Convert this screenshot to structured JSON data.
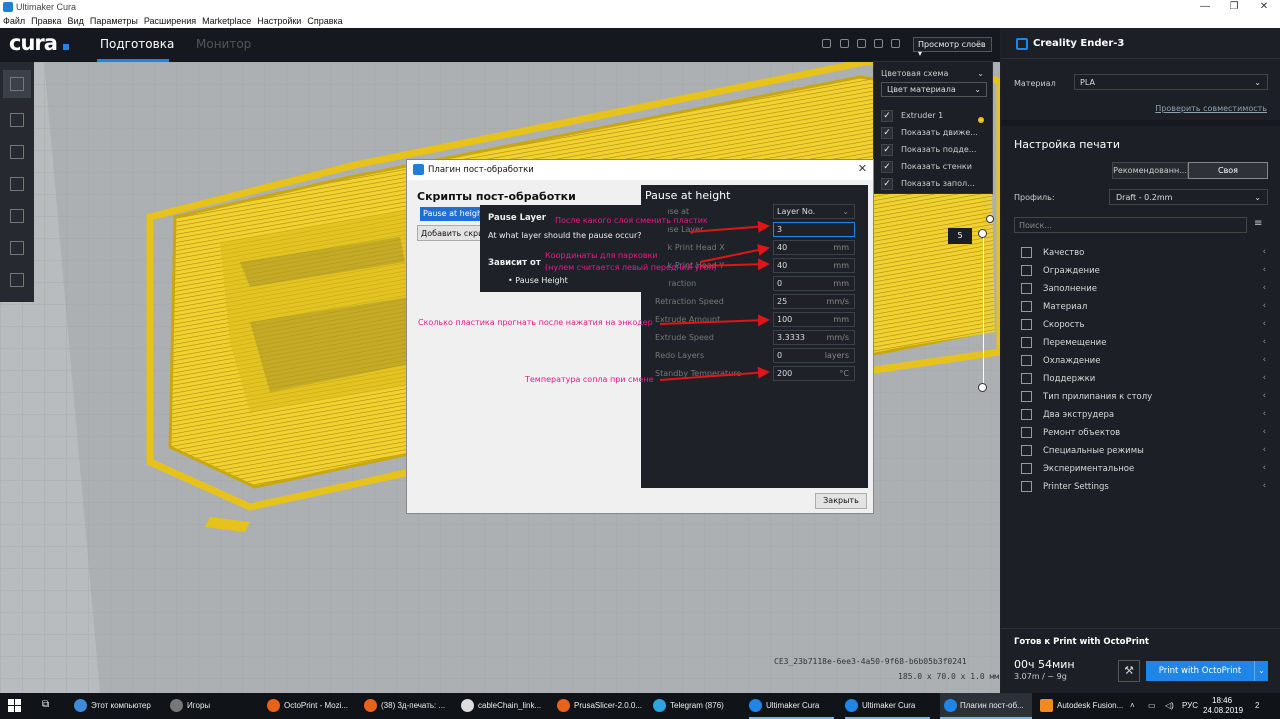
{
  "window": {
    "title": "Ultimaker Cura",
    "min": "—",
    "max": "❐",
    "close": "✕"
  },
  "menu": [
    "Файл",
    "Правка",
    "Вид",
    "Параметры",
    "Расширения",
    "Marketplace",
    "Настройки",
    "Справка"
  ],
  "header": {
    "logo": "cura",
    "tabs": [
      {
        "label": "Подготовка"
      },
      {
        "label": "Монитор"
      }
    ],
    "view_select": "Просмотр слоёв"
  },
  "color_panel": {
    "title": "Цветовая схема",
    "scheme": "Цвет материала",
    "rows": [
      "Extruder 1",
      "Показать движе...",
      "Показать подде...",
      "Показать стенки",
      "Показать запол..."
    ],
    "extruder_color": "#f3c21a"
  },
  "layer_slider": {
    "current": "5"
  },
  "job": {
    "filename": "CE3_23b7118e-6ee3-4a50-9f68-b6b05b3f0241",
    "dims": "185.0 x 70.0 x 1.0 мм"
  },
  "right_panel": {
    "printer": "Creality Ender-3",
    "material_label": "Материал",
    "material": "PLA",
    "compat_link": "Проверить совместимость",
    "print_settings": "Настройка печати",
    "mode_recommended": "Рекомендованн...",
    "mode_custom": "Своя",
    "profile_label": "Профиль:",
    "profile": "Draft - 0.2mm",
    "search_placeholder": "Поиск...",
    "categories": [
      "Качество",
      "Ограждение",
      "Заполнение",
      "Материал",
      "Скорость",
      "Перемещение",
      "Охлаждение",
      "Поддержки",
      "Тип прилипания к столу",
      "Два экструдера",
      "Ремонт объектов",
      "Специальные режимы",
      "Экспериментальное",
      "Printer Settings"
    ]
  },
  "octo": {
    "title": "Готов к Print with OctoPrint",
    "time": "00ч 54мин",
    "amount": "3.07m / ~ 9g",
    "button": "Print with OctoPrint"
  },
  "dialog": {
    "title": "Плагин пост-обработки",
    "scripts_title": "Скрипты пост-обработки",
    "script_item": "Pause at height",
    "add_script": "Добавить скрипт",
    "tooltip_title": "Pause Layer",
    "tooltip_desc": "At what layer should the pause occur?",
    "tooltip_dep": "Зависит от",
    "tooltip_dep_item": "• Pause Height",
    "panel_title": "Pause at height",
    "params": [
      {
        "label": "Pause at",
        "value": "Layer No.",
        "unit": ""
      },
      {
        "label": "Pause Layer",
        "value": "3",
        "unit": ""
      },
      {
        "label": "Park Print Head X",
        "value": "40",
        "unit": "mm"
      },
      {
        "label": "Park Print Head Y",
        "value": "40",
        "unit": "mm"
      },
      {
        "label": "Retraction",
        "value": "0",
        "unit": "mm"
      },
      {
        "label": "Retraction Speed",
        "value": "25",
        "unit": "mm/s"
      },
      {
        "label": "Extrude Amount",
        "value": "100",
        "unit": "mm"
      },
      {
        "label": "Extrude Speed",
        "value": "3.3333",
        "unit": "mm/s"
      },
      {
        "label": "Redo Layers",
        "value": "0",
        "unit": "layers"
      },
      {
        "label": "Standby Temperature",
        "value": "200",
        "unit": "°C"
      }
    ],
    "close_button": "Закрыть"
  },
  "annotations": {
    "a1": "После какого слоя сменить пластик",
    "a2": "Координаты для парковки",
    "a3": "(нулем считается левый передний угол)",
    "a4": "Сколько пластика прогнать после нажатия на энкодер",
    "a5": "Температура сопла при смене",
    "color": "#e8198a"
  },
  "taskbar": {
    "items": [
      {
        "label": "Этот компьютер",
        "color": "#3d8bd9"
      },
      {
        "label": "Игоры",
        "color": "#777777"
      },
      {
        "label": "OctoPrint - Mozi...",
        "color": "#e8631a"
      },
      {
        "label": "(38) 3д-печать: ...",
        "color": "#e8631a"
      },
      {
        "label": "cableChain_link...",
        "color": "#dddddd"
      },
      {
        "label": "PrusaSlicer-2.0.0...",
        "color": "#e8631a"
      },
      {
        "label": "Telegram (876)",
        "color": "#2ca5e0"
      },
      {
        "label": "Ultimaker Cura",
        "color": "#1f86e8"
      },
      {
        "label": "Ultimaker Cura",
        "color": "#1f86e8"
      },
      {
        "label": "Плагин пост-об...",
        "color": "#1f86e8"
      },
      {
        "label": "Autodesk Fusion...",
        "color": "#f28a1e"
      }
    ],
    "lang": "РУС",
    "time": "18:46",
    "date": "24.08.2019",
    "notif": "2"
  }
}
